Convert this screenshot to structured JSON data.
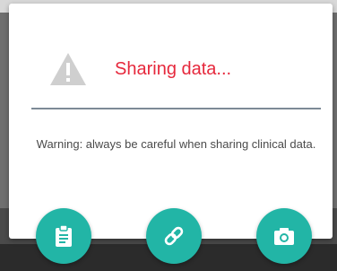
{
  "dialog": {
    "title": "Sharing data...",
    "message": "Warning: always be careful when sharing clinical data.",
    "icon": "warning-icon"
  },
  "actions": [
    {
      "icon": "clipboard-icon"
    },
    {
      "icon": "link-icon"
    },
    {
      "icon": "camera-icon"
    }
  ],
  "colors": {
    "title": "#e6283c",
    "accent": "#22b5a6",
    "divider": "#7d8a96",
    "icon_muted": "#c9c9c9"
  }
}
